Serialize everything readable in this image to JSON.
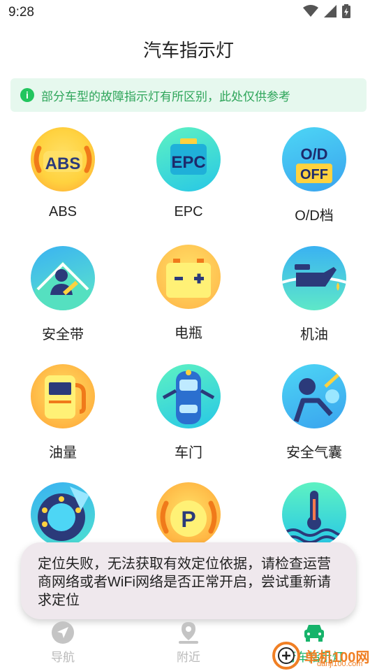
{
  "status_bar": {
    "time": "9:28"
  },
  "page": {
    "title": "汽车指示灯"
  },
  "notice": {
    "text": "部分车型的故障指示灯有所区别，此处仅供参考"
  },
  "indicators": [
    {
      "label": "ABS",
      "icon_text": "ABS",
      "icon": "abs-icon"
    },
    {
      "label": "EPC",
      "icon_text": "EPC",
      "icon": "epc-icon"
    },
    {
      "label": "O/D档",
      "icon_text": "O/D",
      "icon_text2": "OFF",
      "icon": "od-icon"
    },
    {
      "label": "安全带",
      "icon": "seatbelt-icon"
    },
    {
      "label": "电瓶",
      "icon": "battery-icon"
    },
    {
      "label": "机油",
      "icon": "oil-icon"
    },
    {
      "label": "油量",
      "icon": "fuel-icon"
    },
    {
      "label": "车门",
      "icon": "door-icon"
    },
    {
      "label": "安全气囊",
      "icon": "airbag-icon"
    },
    {
      "label": "",
      "icon": "tire-icon"
    },
    {
      "label": "",
      "icon_text": "P",
      "icon": "parking-icon"
    },
    {
      "label": "",
      "icon": "coolant-icon"
    }
  ],
  "toast": {
    "text": "定位失败，无法获取有效定位依据，请检查运营商网络或者WiFi网络是否正常开启，尝试重新请求定位"
  },
  "tabs": [
    {
      "label": "导航",
      "icon": "navigation-icon"
    },
    {
      "label": "附近",
      "icon": "nearby-icon"
    },
    {
      "label": "行车指示灯",
      "icon": "car-icon"
    }
  ],
  "watermark": {
    "text": "单机100网",
    "sub": "danji100.com"
  }
}
